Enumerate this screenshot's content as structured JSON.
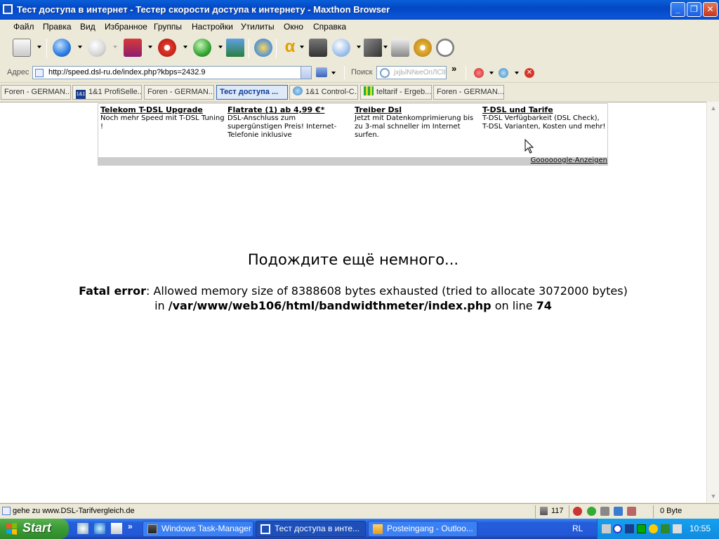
{
  "window": {
    "title": "Тест доступа в интернет - Тестер скорости доступа к интернету - Maxthon Browser"
  },
  "menu": [
    "Файл",
    "Правка",
    "Вид",
    "Избранное",
    "Группы",
    "Настройки",
    "Утилиты",
    "Окно",
    "Справка"
  ],
  "toolbar_icons": [
    "new-page-icon",
    "back-icon",
    "forward-icon",
    "close-page-icon",
    "stop-icon",
    "refresh-icon",
    "home-icon",
    "favorites-icon",
    "alpha-icon",
    "screenshot-icon",
    "mouse-gestures-icon",
    "tools-icon",
    "plugin-icon",
    "options-icon",
    "timer-icon"
  ],
  "address": {
    "label": "Адрес",
    "url": "http://speed.dsl-ru.de/index.php?kbps=2432.9"
  },
  "search": {
    "label": "Поиск",
    "placeholder": "јхјЬlN№eOпЛСlI"
  },
  "tabs": [
    {
      "label": "Foren - GERMAN...",
      "active": false
    },
    {
      "label": "1&1 ProfiSelle...",
      "active": false
    },
    {
      "label": "Foren - GERMAN...",
      "active": false
    },
    {
      "label": "Тест доступа ...",
      "active": true
    },
    {
      "label": "1&1 Control-C...",
      "active": false
    },
    {
      "label": "teltarif - Ergeb...",
      "active": false
    },
    {
      "label": "Foren - GERMAN...",
      "active": false
    }
  ],
  "ads": {
    "items": [
      {
        "headline": "Telekom T-DSL Upgrade",
        "text": "Noch mehr Speed mit T-DSL Tuning !"
      },
      {
        "headline": "Flatrate (1) ab 4,99 €*",
        "text": "DSL-Anschluss zum supergünstigen Preis! Internet-Telefonie inklusive"
      },
      {
        "headline": "Treiber Dsl",
        "text": "Jetzt mit Datenkomprimierung bis zu 3-mal schneller im Internet surfen."
      },
      {
        "headline": "T-DSL und Tarife",
        "text": "T-DSL Verfügbarkeit (DSL Check), T-DSL Varianten, Kosten und mehr!"
      }
    ],
    "footer": "Goooooogle-Anzeigen"
  },
  "page": {
    "wait_text": "Подождите ещё немного...",
    "error_label": "Fatal error",
    "error_text_1": ": Allowed memory size of 8388608 bytes exhausted (tried to allocate 3072000 bytes)",
    "error_in": "in",
    "error_path": "/var/www/web106/html/bandwidthmeter/index.php",
    "error_on_line": "on line",
    "error_line": "74"
  },
  "status": {
    "text": "gehe zu www.DSL-Tarifvergleich.de",
    "count": "117",
    "bytes": "0 Byte"
  },
  "taskbar": {
    "start": "Start",
    "tasks": [
      {
        "label": "Windows Task-Manager",
        "active": false
      },
      {
        "label": "Тест доступа в инте...",
        "active": true
      },
      {
        "label": "Posteingang - Outloo...",
        "active": false
      }
    ],
    "lang": "RL",
    "clock": "10:55"
  }
}
